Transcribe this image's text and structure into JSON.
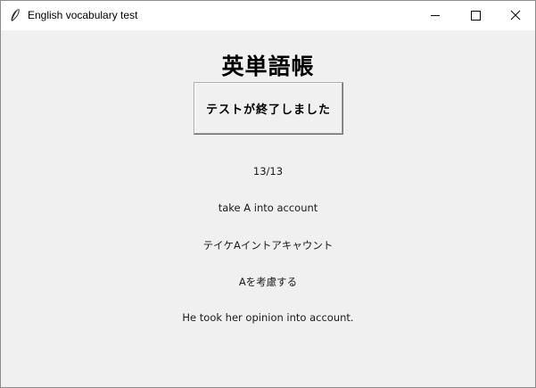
{
  "window": {
    "title": "English vocabulary test",
    "icon": "feather-icon"
  },
  "controls": {
    "minimize_icon": "minimize-icon",
    "maximize_icon": "maximize-icon",
    "close_icon": "close-icon"
  },
  "main": {
    "heading": "英単語帳",
    "button_label": "テストが終了しました",
    "progress": "13/13",
    "word": "take A into account",
    "reading": "テイケAイントアキャウント",
    "meaning": "Aを考慮する",
    "example": "He took her opinion into account."
  }
}
